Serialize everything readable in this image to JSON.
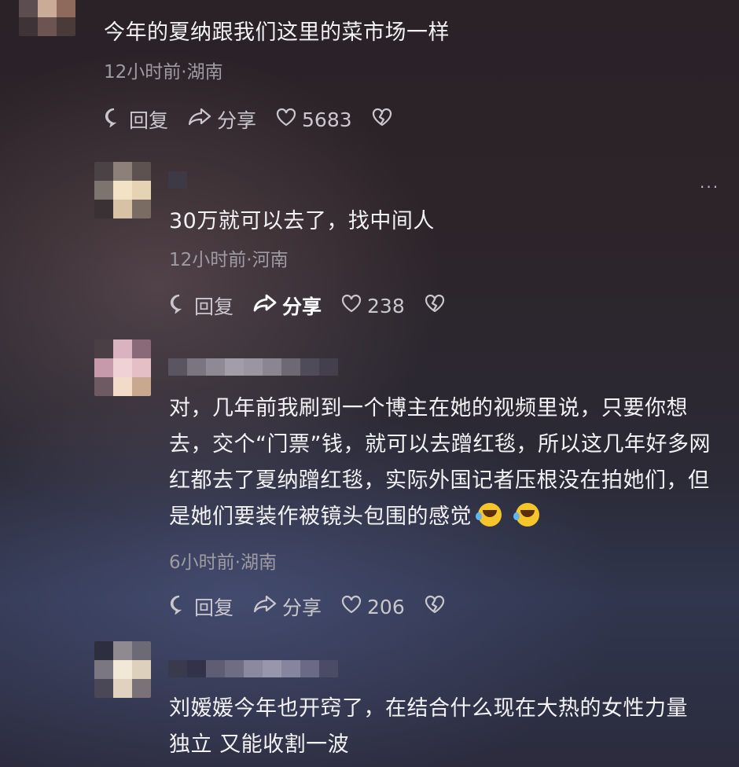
{
  "comments": [
    {
      "text": "今年的夏纳跟我们这里的菜市场一样",
      "meta": "12小时前·湖南",
      "reply_label": "回复",
      "share_label": "分享",
      "likes": "5683"
    },
    {
      "text": "30万就可以去了，找中间人",
      "meta": "12小时前·河南",
      "reply_label": "回复",
      "share_label": "分享",
      "likes": "238"
    },
    {
      "text": "对，几年前我刷到一个博主在她的视频里说，只要你想去，交个“门票”钱，就可以去蹭红毯，所以这几年好多网红都去了夏纳蹭红毯，实际外国记者压根没在拍她们，但是她们要装作被镜头包围的感觉",
      "meta": "6小时前·湖南",
      "reply_label": "回复",
      "share_label": "分享",
      "likes": "206"
    },
    {
      "text": "刘嫒媛今年也开窍了，在结合什么现在大热的女性力量 独立 又能收割一波"
    }
  ],
  "more_label": "···",
  "icons": {
    "reply": "comment-bubble-icon",
    "share": "share-arrow-icon",
    "like": "heart-icon",
    "dislike": "broken-heart-icon",
    "emoji": "rolling-laughing-emoji-icon"
  }
}
